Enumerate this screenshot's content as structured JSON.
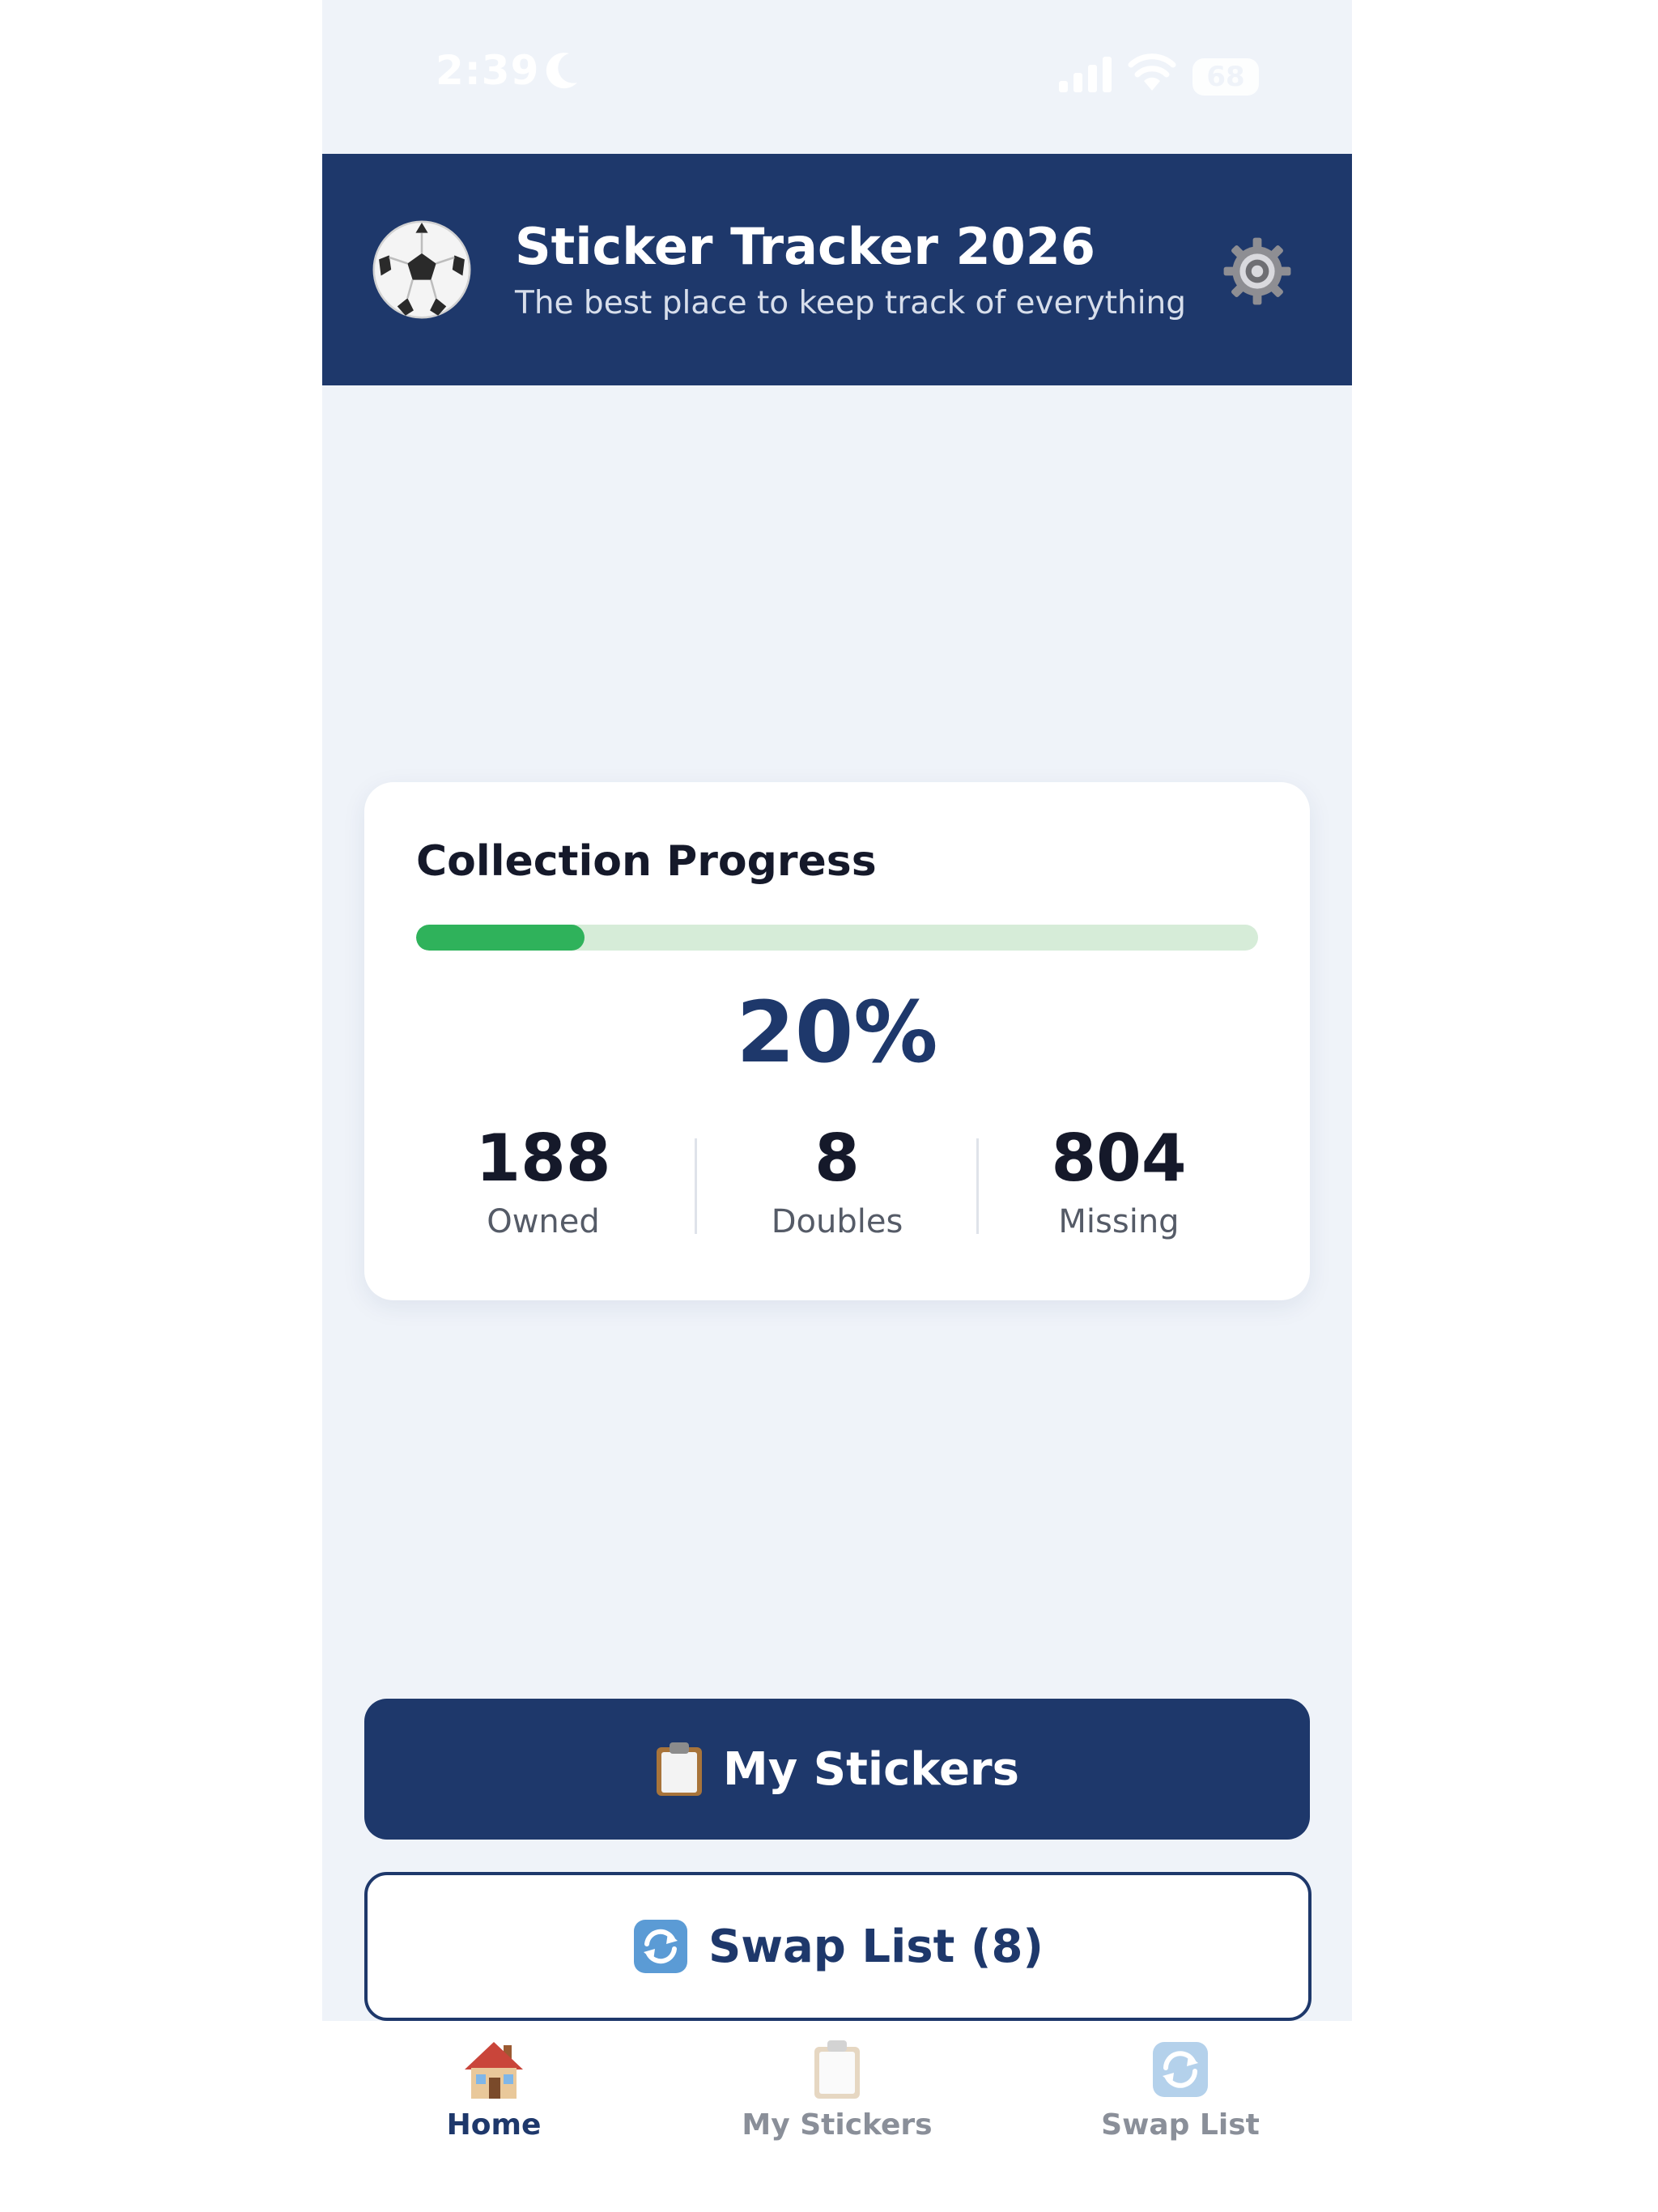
{
  "status_bar": {
    "time": "2:39",
    "battery": "68"
  },
  "header": {
    "title": "Sticker Tracker 2026",
    "subtitle": "The best place to keep track of everything",
    "logo_icon": "soccer-ball-icon",
    "settings_icon": "gear-icon"
  },
  "progress": {
    "title": "Collection Progress",
    "percent_label": "20%",
    "fraction": 0.2,
    "stats": [
      {
        "value": "188",
        "label": "Owned"
      },
      {
        "value": "8",
        "label": "Doubles"
      },
      {
        "value": "804",
        "label": "Missing"
      }
    ]
  },
  "actions": {
    "my_stickers_label": "My Stickers",
    "my_stickers_icon": "clipboard-icon",
    "swap_list_label": "Swap List (8)",
    "swap_list_icon": "swap-arrows-icon"
  },
  "tab_bar": {
    "tabs": [
      {
        "label": "Home",
        "icon": "house-icon",
        "active": true
      },
      {
        "label": "My Stickers",
        "icon": "clipboard-icon",
        "active": false
      },
      {
        "label": "Swap List",
        "icon": "swap-arrows-icon",
        "active": false
      }
    ]
  },
  "colors": {
    "primary": "#1e386b",
    "progress_fill": "#2fb25b",
    "progress_track": "#d6ecd8",
    "background": "#eff3f9",
    "tab_inactive": "#8a8f99"
  }
}
